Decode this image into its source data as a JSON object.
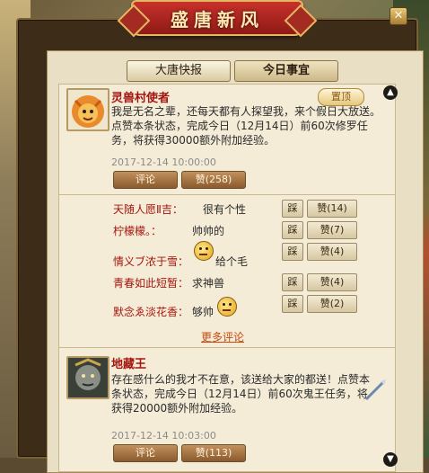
{
  "window": {
    "title": "盛唐新风",
    "close_glyph": "✕"
  },
  "tabs": [
    "大唐快报",
    "今日事宜"
  ],
  "scroll": {
    "up": "▲",
    "down": "▼"
  },
  "post1": {
    "author": "灵兽村使者",
    "pin_label": "置顶",
    "text": "我是无名之辈，还每天都有人探望我，来个假日大放送。点赞本条状态，完成今日（12月14日）前60次修罗任务，将获得30000额外附加经验。",
    "time": "2017-12-14  10:00:00",
    "comment_label": "评论",
    "like_label": "赞(258)"
  },
  "comments": [
    {
      "name": "天随人愿Ⅱ吉：",
      "text": "很有个性",
      "emoji": false,
      "step": "踩",
      "like": "赞(14)"
    },
    {
      "name": "柠檬檬。：",
      "text": "帅帅的",
      "emoji": true,
      "step": "踩",
      "like": "赞(7)"
    },
    {
      "name": "情义ブ浓于雪：",
      "text": "给个毛",
      "emoji": true,
      "step": "踩",
      "like": "赞(4)"
    },
    {
      "name": "青春如此短暂：",
      "text": "求神兽",
      "emoji": false,
      "step": "踩",
      "like": "赞(4)"
    },
    {
      "name": "默念ゑ淡花香：",
      "text": "够帅",
      "emoji": true,
      "step": "踩",
      "like": "赞(2)"
    }
  ],
  "more_comments": "更多评论",
  "post2": {
    "author": "地藏王",
    "text": "存在感什么的我才不在意，该送给大家的都送！点赞本条状态，完成今日（12月14日）前60次鬼王任务，将获得20000额外附加经验。",
    "time": "2017-12-14  10:03:00",
    "comment_label": "评论",
    "like_label": "赞(113)"
  },
  "colors": {
    "banner": "#c8312a",
    "author": "#a4150e",
    "link": "#c84a10",
    "paper": "#e8dfc4"
  }
}
